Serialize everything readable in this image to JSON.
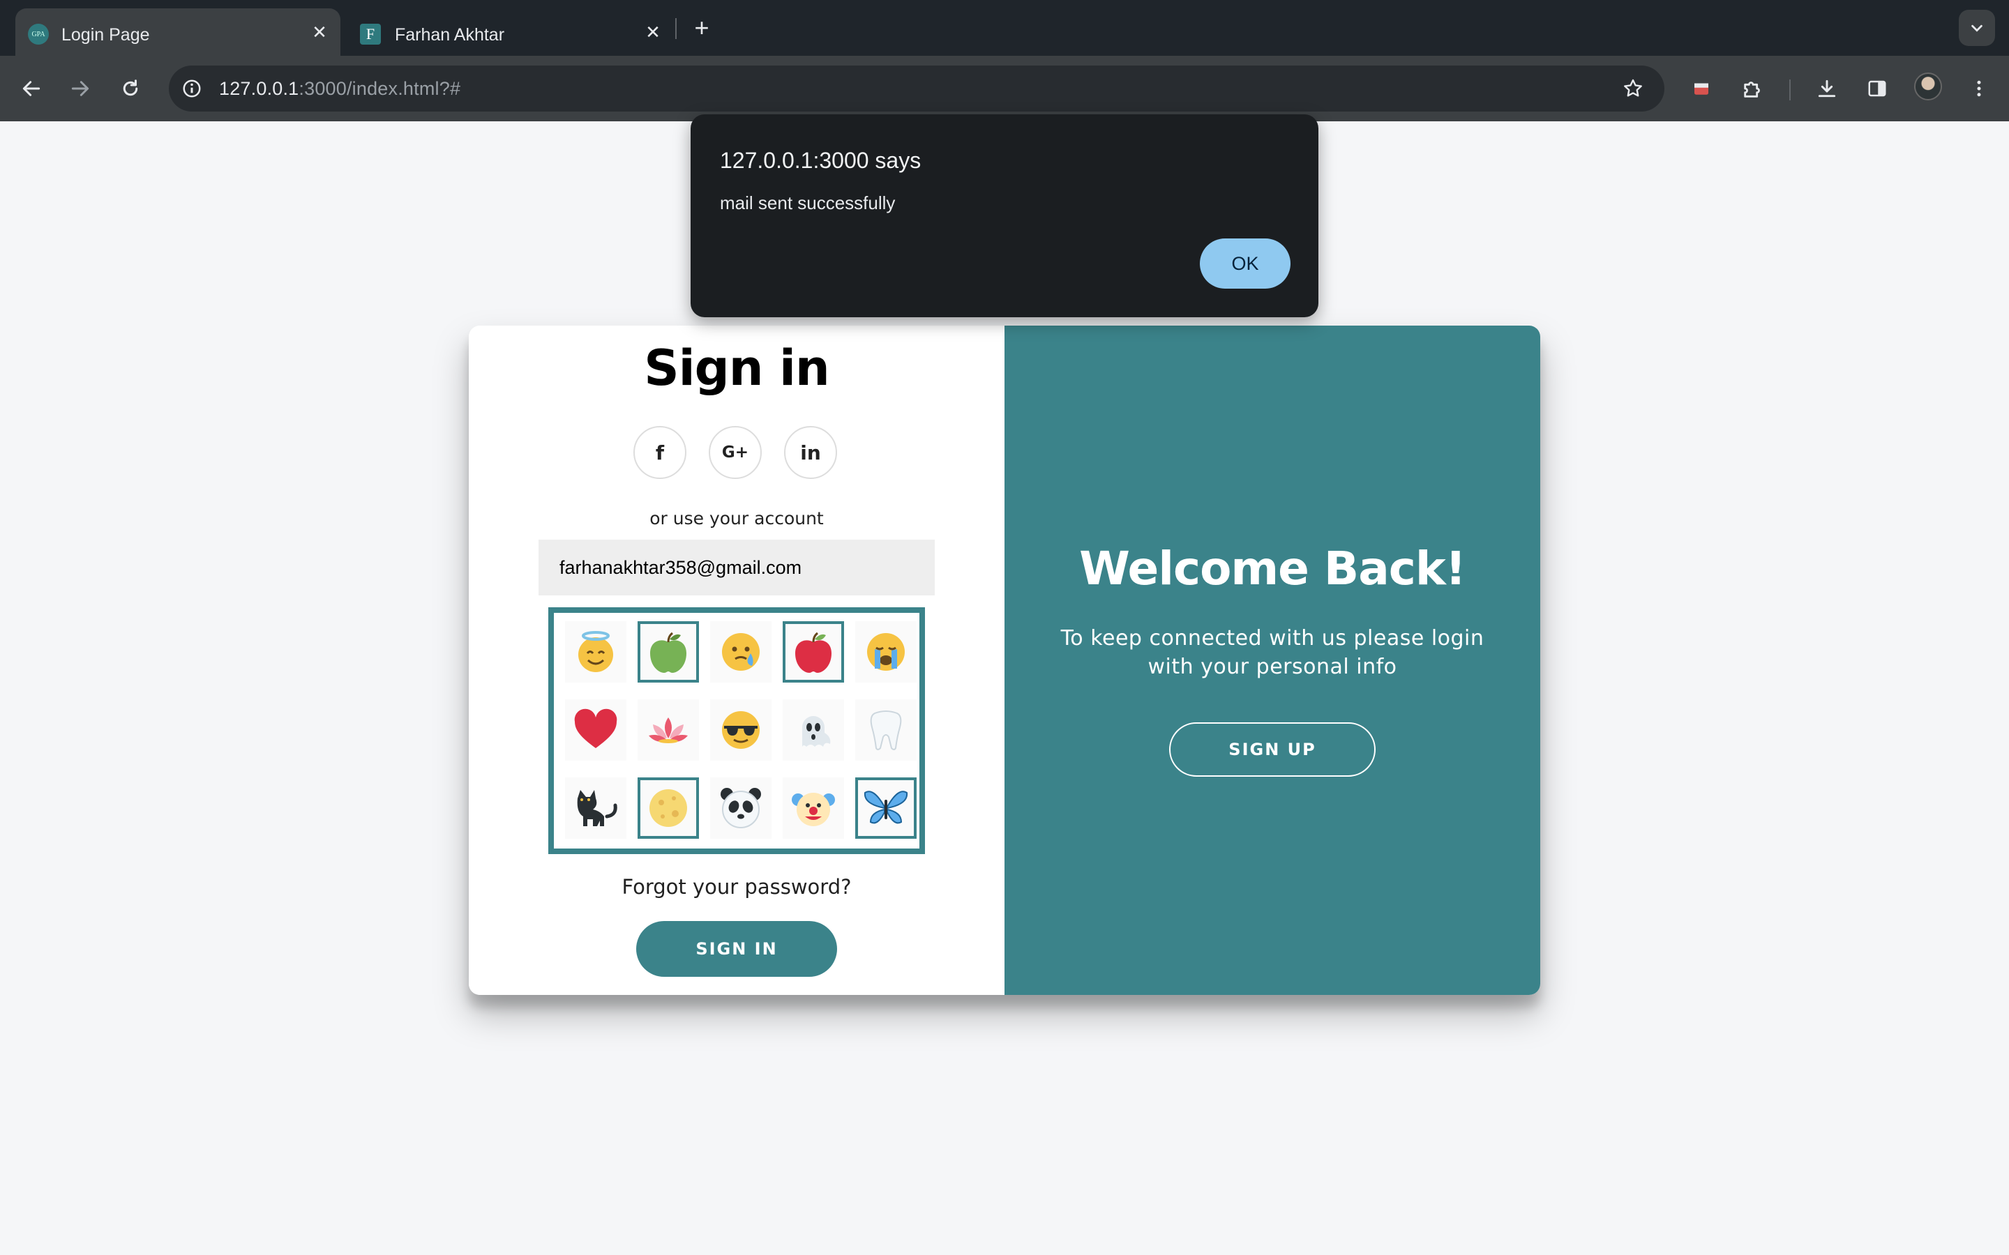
{
  "browser": {
    "tabs": [
      {
        "title": "Login Page",
        "favicon_text": "GPA",
        "active": true
      },
      {
        "title": "Farhan Akhtar",
        "favicon_text": "F",
        "active": false
      }
    ],
    "url_host": "127.0.0.1",
    "url_rest": ":3000/index.html?#",
    "tab_close_glyph": "✕",
    "new_tab_glyph": "+"
  },
  "dialog": {
    "title": "127.0.0.1:3000 says",
    "message": "mail sent successfully",
    "ok_label": "OK"
  },
  "signin": {
    "title": "Sign in",
    "social": [
      {
        "name": "facebook",
        "glyph": "f"
      },
      {
        "name": "google-plus",
        "glyph": "G+"
      },
      {
        "name": "linkedin",
        "glyph": "in"
      }
    ],
    "alt_text": "or use your account",
    "email_value": "farhanakhtar358@gmail.com",
    "picture_grid": [
      {
        "icon": "smiling-face-with-halo-icon",
        "selected": false
      },
      {
        "icon": "green-apple-icon",
        "selected": true
      },
      {
        "icon": "face-holding-back-tears-icon",
        "selected": false
      },
      {
        "icon": "red-apple-icon",
        "selected": true
      },
      {
        "icon": "loudly-crying-face-icon",
        "selected": false
      },
      {
        "icon": "red-heart-icon",
        "selected": false
      },
      {
        "icon": "lotus-icon",
        "selected": false
      },
      {
        "icon": "sunglasses-face-icon",
        "selected": false
      },
      {
        "icon": "ghost-icon",
        "selected": false
      },
      {
        "icon": "tooth-icon",
        "selected": false
      },
      {
        "icon": "black-cat-icon",
        "selected": false
      },
      {
        "icon": "full-moon-icon",
        "selected": true
      },
      {
        "icon": "panda-icon",
        "selected": false
      },
      {
        "icon": "clown-face-icon",
        "selected": false
      },
      {
        "icon": "butterfly-icon",
        "selected": true
      }
    ],
    "forgot_text": "Forgot your password?",
    "button_label": "SIGN IN"
  },
  "welcome": {
    "title": "Welcome Back!",
    "subtitle": "To keep connected with us please login with your personal info",
    "button_label": "SIGN UP"
  },
  "colors": {
    "accent": "#3b838a",
    "dialog_bg": "#1b1e21",
    "dialog_ok": "#8fc9f0"
  }
}
